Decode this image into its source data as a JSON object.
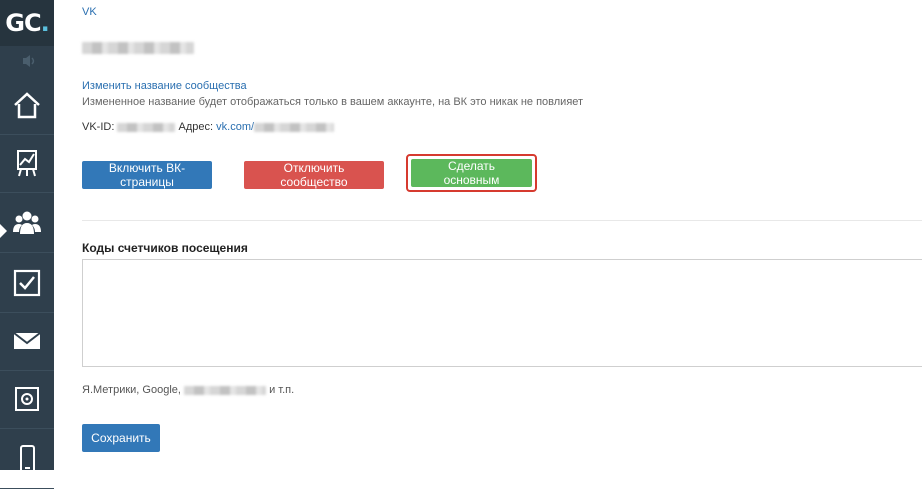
{
  "sidebar": {
    "logo_main": "GC",
    "logo_accent": ".",
    "items": [
      {
        "icon": "home-icon"
      },
      {
        "icon": "chart-icon"
      },
      {
        "icon": "users-icon"
      },
      {
        "icon": "tasks-icon"
      },
      {
        "icon": "mail-icon"
      },
      {
        "icon": "safe-icon"
      },
      {
        "icon": "mobile-icon"
      }
    ]
  },
  "community": {
    "network_label": "VK",
    "rename_link": "Изменить название сообщества",
    "rename_note": "Измененное название будет отображаться только в вашем аккаунте, на ВК это никак не повлияет",
    "vk_id_label": "VK-ID:",
    "address_label": "Адрес:",
    "address_prefix": "vk.com/"
  },
  "actions": {
    "enable_pages": "Включить ВК-страницы",
    "disable_community": "Отключить сообщество",
    "make_main": "Сделать основным"
  },
  "counters": {
    "title": "Коды счетчиков посещения",
    "value": "",
    "hint_prefix": "Я.Метрики, Google,",
    "hint_suffix": "и т.п."
  },
  "save_label": "Сохранить",
  "colors": {
    "sidebar_bg": "#2f3f4c",
    "primary": "#3278b8",
    "danger": "#d9534f",
    "success": "#5cb85c",
    "highlight": "#d63a2f",
    "link": "#2a6fb0"
  }
}
